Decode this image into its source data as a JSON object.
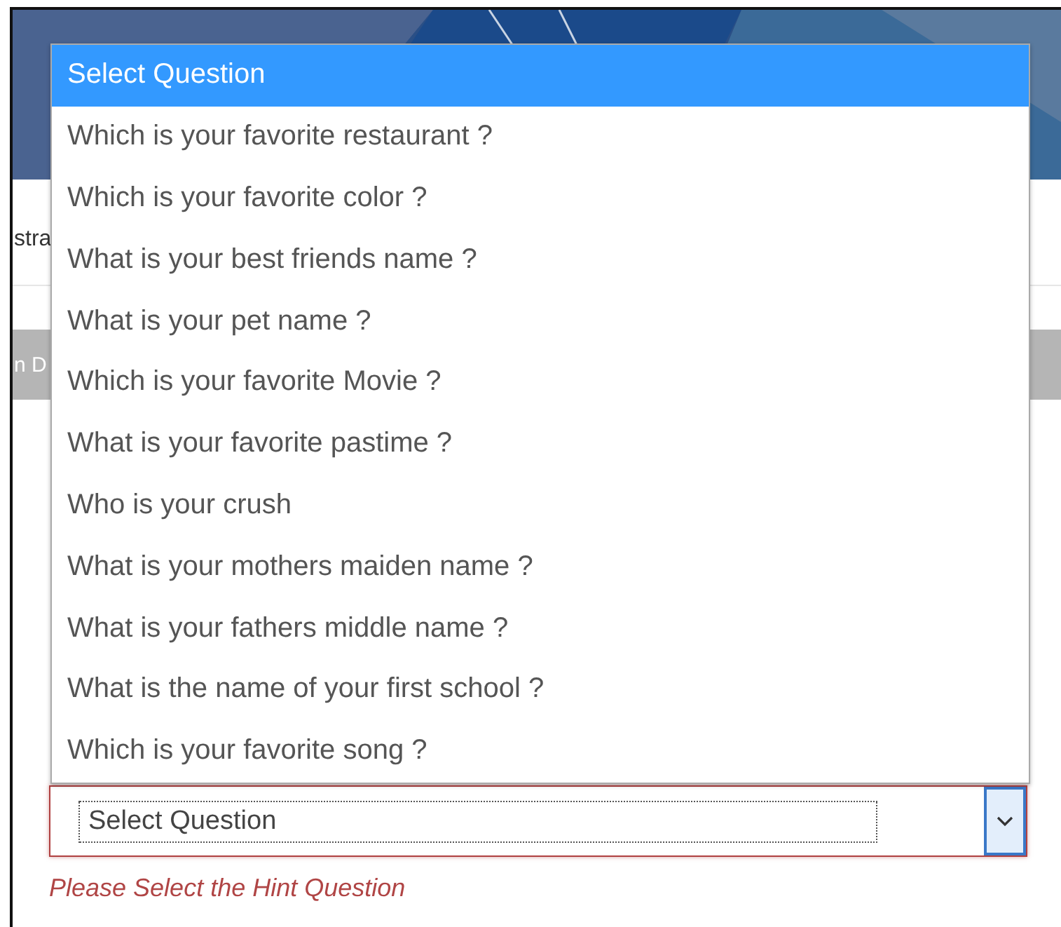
{
  "page": {
    "heading_fragment": "stra",
    "tab_bar_fragment": "n D"
  },
  "hint_question": {
    "value": "Select Question",
    "error": "Please Select the Hint Question",
    "expanded": true,
    "options": [
      {
        "label": "Select Question",
        "selected": true
      },
      {
        "label": "Which is your favorite restaurant ?",
        "selected": false
      },
      {
        "label": "Which is your favorite color ?",
        "selected": false
      },
      {
        "label": "What is your best friends name ?",
        "selected": false
      },
      {
        "label": "What is your pet name ?",
        "selected": false
      },
      {
        "label": "Which is your favorite Movie ?",
        "selected": false
      },
      {
        "label": "What is your favorite pastime ?",
        "selected": false
      },
      {
        "label": "Who is your crush",
        "selected": false
      },
      {
        "label": "What is your mothers maiden name ?",
        "selected": false
      },
      {
        "label": "What is your fathers middle name ?",
        "selected": false
      },
      {
        "label": "What is the name of your first school ?",
        "selected": false
      },
      {
        "label": "Which is your favorite song ?",
        "selected": false
      }
    ]
  }
}
